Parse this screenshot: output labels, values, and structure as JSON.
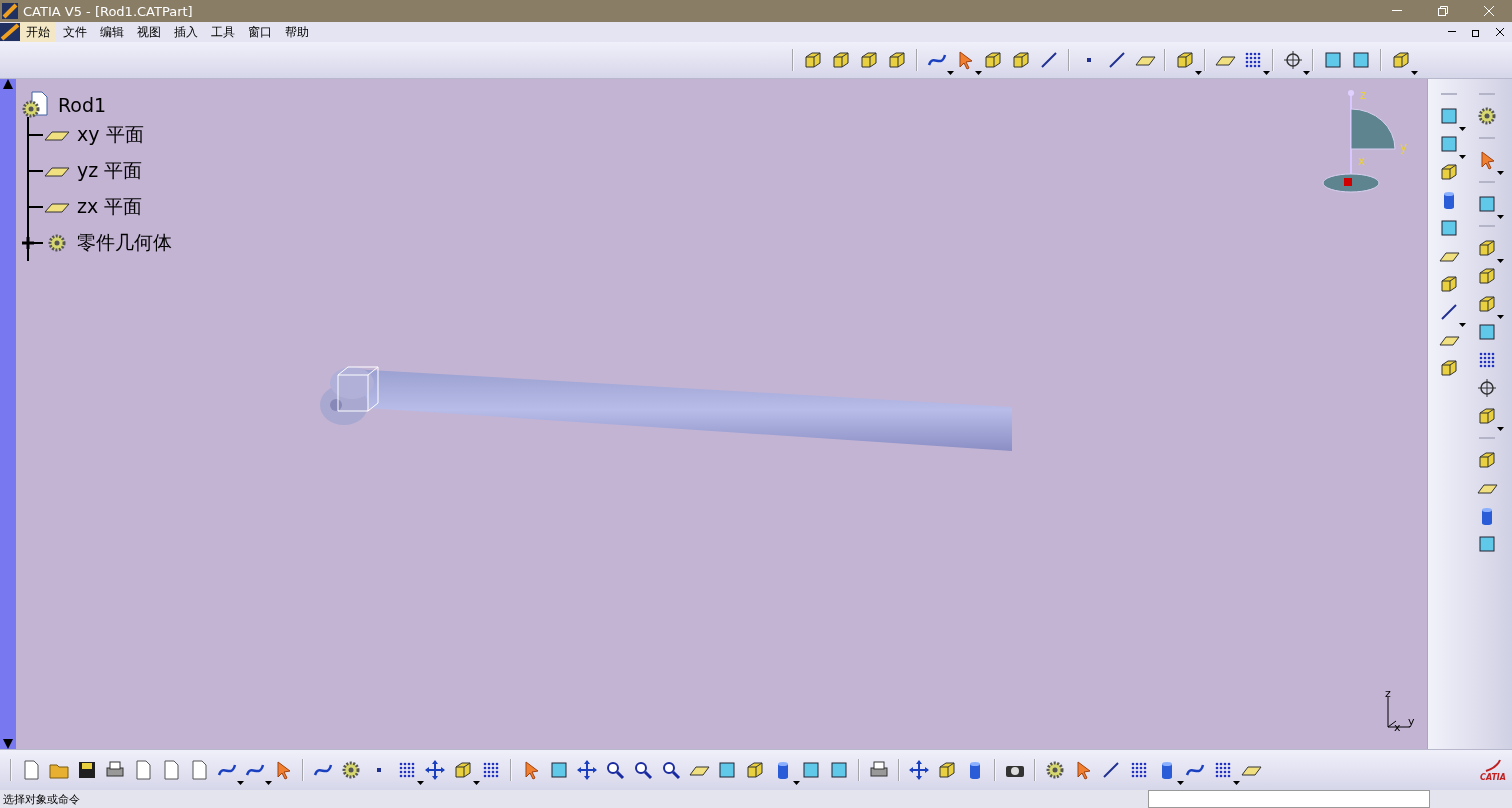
{
  "window": {
    "title": "CATIA V5  - [Rod1.CATPart]"
  },
  "menu": [
    {
      "label": "开始",
      "selected": true
    },
    {
      "label": "文件",
      "selected": false
    },
    {
      "label": "编辑",
      "selected": false
    },
    {
      "label": "视图",
      "selected": false
    },
    {
      "label": "插入",
      "selected": false
    },
    {
      "label": "工具",
      "selected": false
    },
    {
      "label": "窗口",
      "selected": false
    },
    {
      "label": "帮助",
      "selected": false
    }
  ],
  "tree": {
    "label": "Rod1",
    "children": [
      {
        "label": "xy 平面",
        "kind": "plane"
      },
      {
        "label": "yz 平面",
        "kind": "plane"
      },
      {
        "label": "zx 平面",
        "kind": "plane"
      },
      {
        "label": "零件几何体",
        "kind": "body",
        "expanded": false
      }
    ]
  },
  "compass": {
    "labels": [
      "z",
      "y",
      "x"
    ]
  },
  "axis_triad": {
    "labels": [
      "z",
      "x",
      "y"
    ]
  },
  "brand_logo": {
    "text": "CATIA"
  },
  "status_bar": {
    "message": "选择对象或命令"
  }
}
